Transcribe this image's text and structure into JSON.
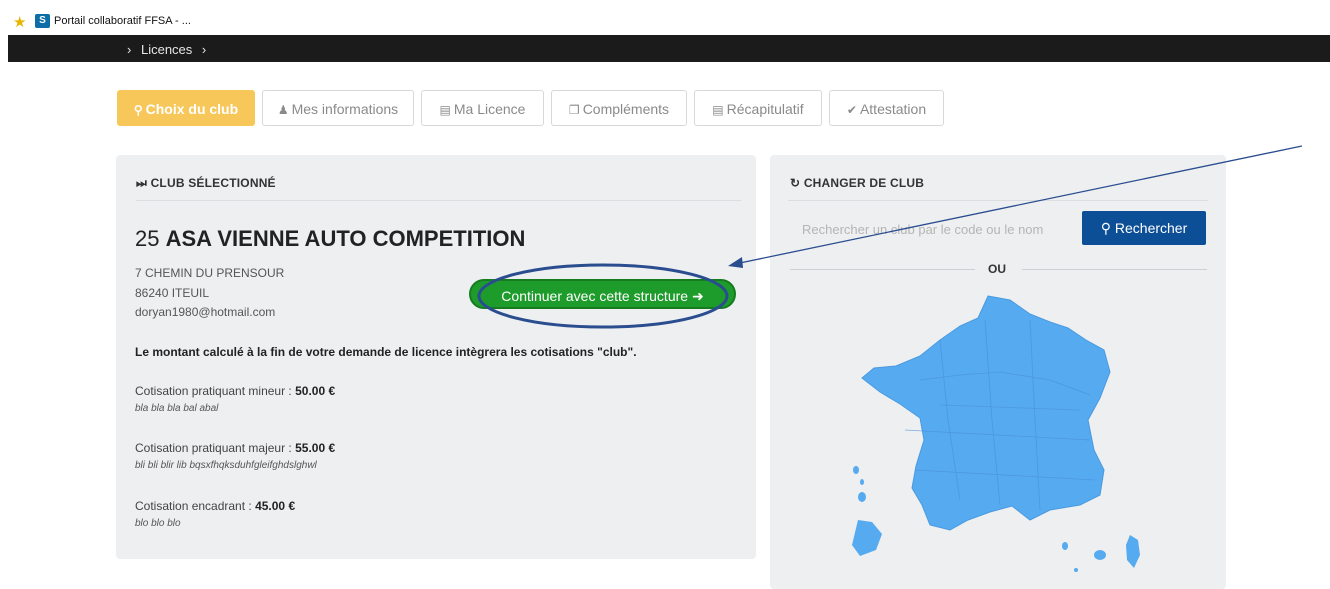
{
  "browser": {
    "tab_title": "Portail collaboratif FFSA - ...",
    "icon": "sharepoint-icon",
    "fav_icon": "star-icon"
  },
  "breadcrumb": {
    "items": [
      "Licences"
    ]
  },
  "steps": [
    {
      "label": "Choix du club",
      "icon": "map-marker-icon",
      "active": true
    },
    {
      "label": "Mes informations",
      "icon": "user-icon",
      "active": false
    },
    {
      "label": "Ma Licence",
      "icon": "id-card-icon",
      "active": false
    },
    {
      "label": "Compléments",
      "icon": "copy-icon",
      "active": false
    },
    {
      "label": "Récapitulatif",
      "icon": "list-icon",
      "active": false
    },
    {
      "label": "Attestation",
      "icon": "check-circle-icon",
      "active": false
    }
  ],
  "selected_club": {
    "title": "CLUB SÉLECTIONNÉ",
    "number": "25",
    "name": "ASA VIENNE AUTO COMPETITION",
    "address1": "7 CHEMIN DU PRENSOUR",
    "address2": "86240 ITEUIL",
    "email": "doryan1980@hotmail.com",
    "continue_label": "Continuer avec cette structure",
    "note": "Le montant calculé à la fin de votre demande de licence intègrera les cotisations \"club\".",
    "cotisations": [
      {
        "label": "Cotisation pratiquant mineur : ",
        "amount": "50.00 €",
        "desc": "bla bla bla bal abal"
      },
      {
        "label": "Cotisation pratiquant majeur : ",
        "amount": "55.00 €",
        "desc": "bli bli blir lib bqsxfhqksduhfgleifghdslghwl"
      },
      {
        "label": "Cotisation encadrant : ",
        "amount": "45.00 €",
        "desc": "blo blo blo"
      }
    ]
  },
  "change_club": {
    "title": "CHANGER DE CLUB",
    "search_placeholder": "Rechercher un club par le code ou le nom",
    "search_button": "Rechercher",
    "separator": "OU",
    "map": "france-departments-map",
    "map_color": "#55aaf0"
  },
  "colors": {
    "active_step": "#f7c75a",
    "continue_button": "#1e9c2b",
    "search_button": "#0d4f97",
    "annotation": "#2a4d8f"
  }
}
